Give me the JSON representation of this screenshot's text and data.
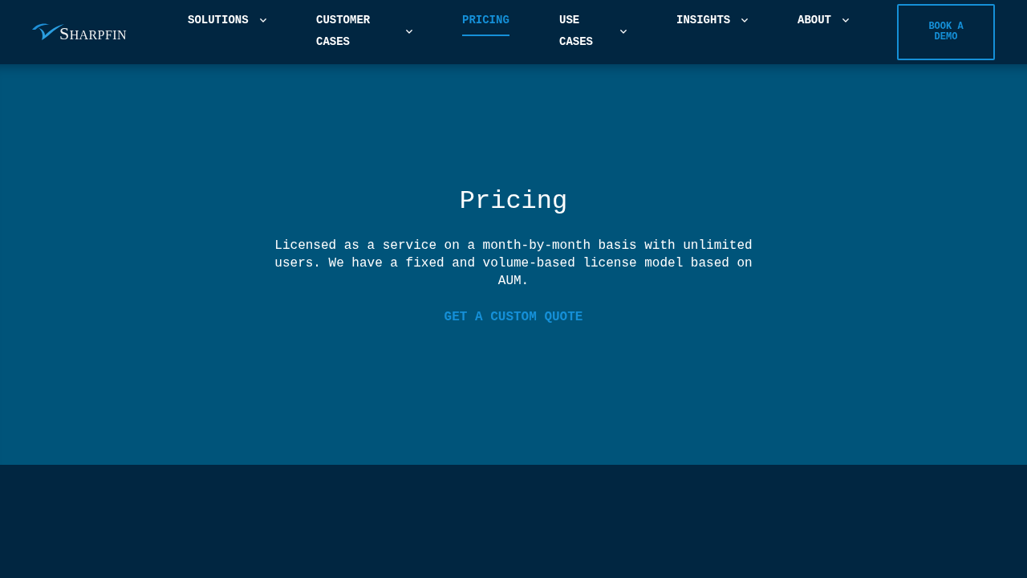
{
  "header": {
    "logo": {
      "text": "SHARPFIN"
    },
    "nav": [
      {
        "label": "SOLUTIONS",
        "has_menu": true,
        "selected": false
      },
      {
        "label": "CUSTOMER CASES",
        "has_menu": true,
        "selected": false
      },
      {
        "label": "PRICING",
        "has_menu": false,
        "selected": true
      },
      {
        "label": "USE CASES",
        "has_menu": true,
        "selected": false
      },
      {
        "label": "INSIGHTS",
        "has_menu": true,
        "selected": false
      },
      {
        "label": "ABOUT",
        "has_menu": true,
        "selected": false
      }
    ],
    "cta_button": {
      "label": "BOOK A DEMO"
    }
  },
  "hero": {
    "title": "Pricing",
    "text": "Licensed as a service on a month-by-month basis with unlimited users. We have a fixed and volume-based license model based on AUM.",
    "link": "GET A CUSTOM QUOTE"
  }
}
